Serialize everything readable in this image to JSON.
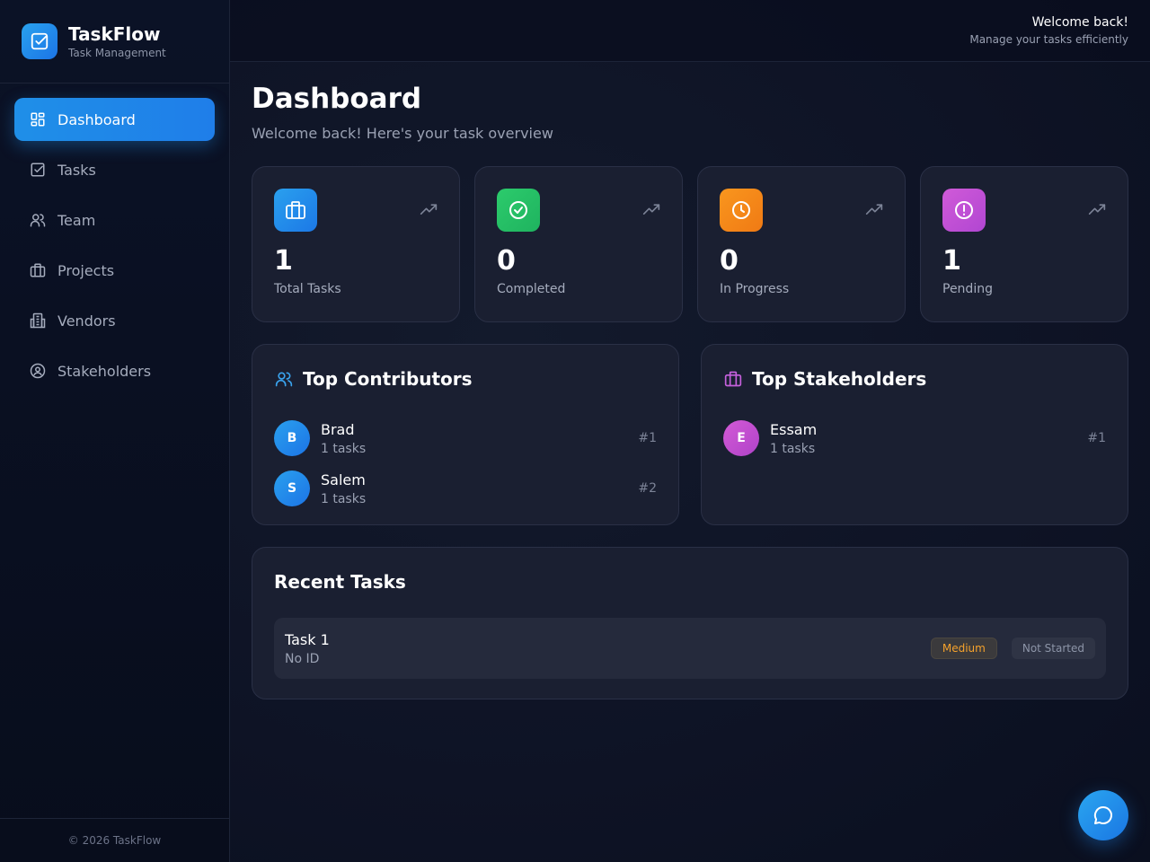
{
  "brand": {
    "name": "TaskFlow",
    "subtitle": "Task Management",
    "icon": "check-square-icon",
    "accent": "#1f8fe8"
  },
  "sidebar": {
    "items": [
      {
        "label": "Dashboard",
        "icon": "grid-icon",
        "active": true
      },
      {
        "label": "Tasks",
        "icon": "check-square-icon"
      },
      {
        "label": "Team",
        "icon": "users-icon"
      },
      {
        "label": "Projects",
        "icon": "briefcase-icon"
      },
      {
        "label": "Vendors",
        "icon": "building-icon"
      },
      {
        "label": "Stakeholders",
        "icon": "user-circle-icon"
      }
    ],
    "footer": "© 2026 TaskFlow"
  },
  "topbar": {
    "title": "Welcome back!",
    "subtitle": "Manage your tasks efficiently"
  },
  "page": {
    "title": "Dashboard",
    "subtitle": "Welcome back! Here's your task overview"
  },
  "stats": [
    {
      "value": "1",
      "label": "Total Tasks",
      "icon": "briefcase-icon",
      "color": "#1f8fe8"
    },
    {
      "value": "0",
      "label": "Completed",
      "icon": "check-circle-icon",
      "color": "#22c06a"
    },
    {
      "value": "0",
      "label": "In Progress",
      "icon": "clock-icon",
      "color": "#f58a1f"
    },
    {
      "value": "1",
      "label": "Pending",
      "icon": "alert-circle-icon",
      "color": "#c750d6"
    }
  ],
  "contributors": {
    "title": "Top Contributors",
    "people": [
      {
        "initial": "B",
        "name": "Brad",
        "count": "1 tasks",
        "rank": "#1"
      },
      {
        "initial": "S",
        "name": "Salem",
        "count": "1 tasks",
        "rank": "#2"
      }
    ]
  },
  "stakeholders": {
    "title": "Top Stakeholders",
    "people": [
      {
        "initial": "E",
        "name": "Essam",
        "count": "1 tasks",
        "rank": "#1"
      }
    ]
  },
  "recent": {
    "title": "Recent Tasks",
    "tasks": [
      {
        "name": "Task 1",
        "id": "No ID",
        "priority": "Medium",
        "status": "Not Started"
      }
    ]
  },
  "chat": {
    "icon": "chat-bubble-icon"
  }
}
